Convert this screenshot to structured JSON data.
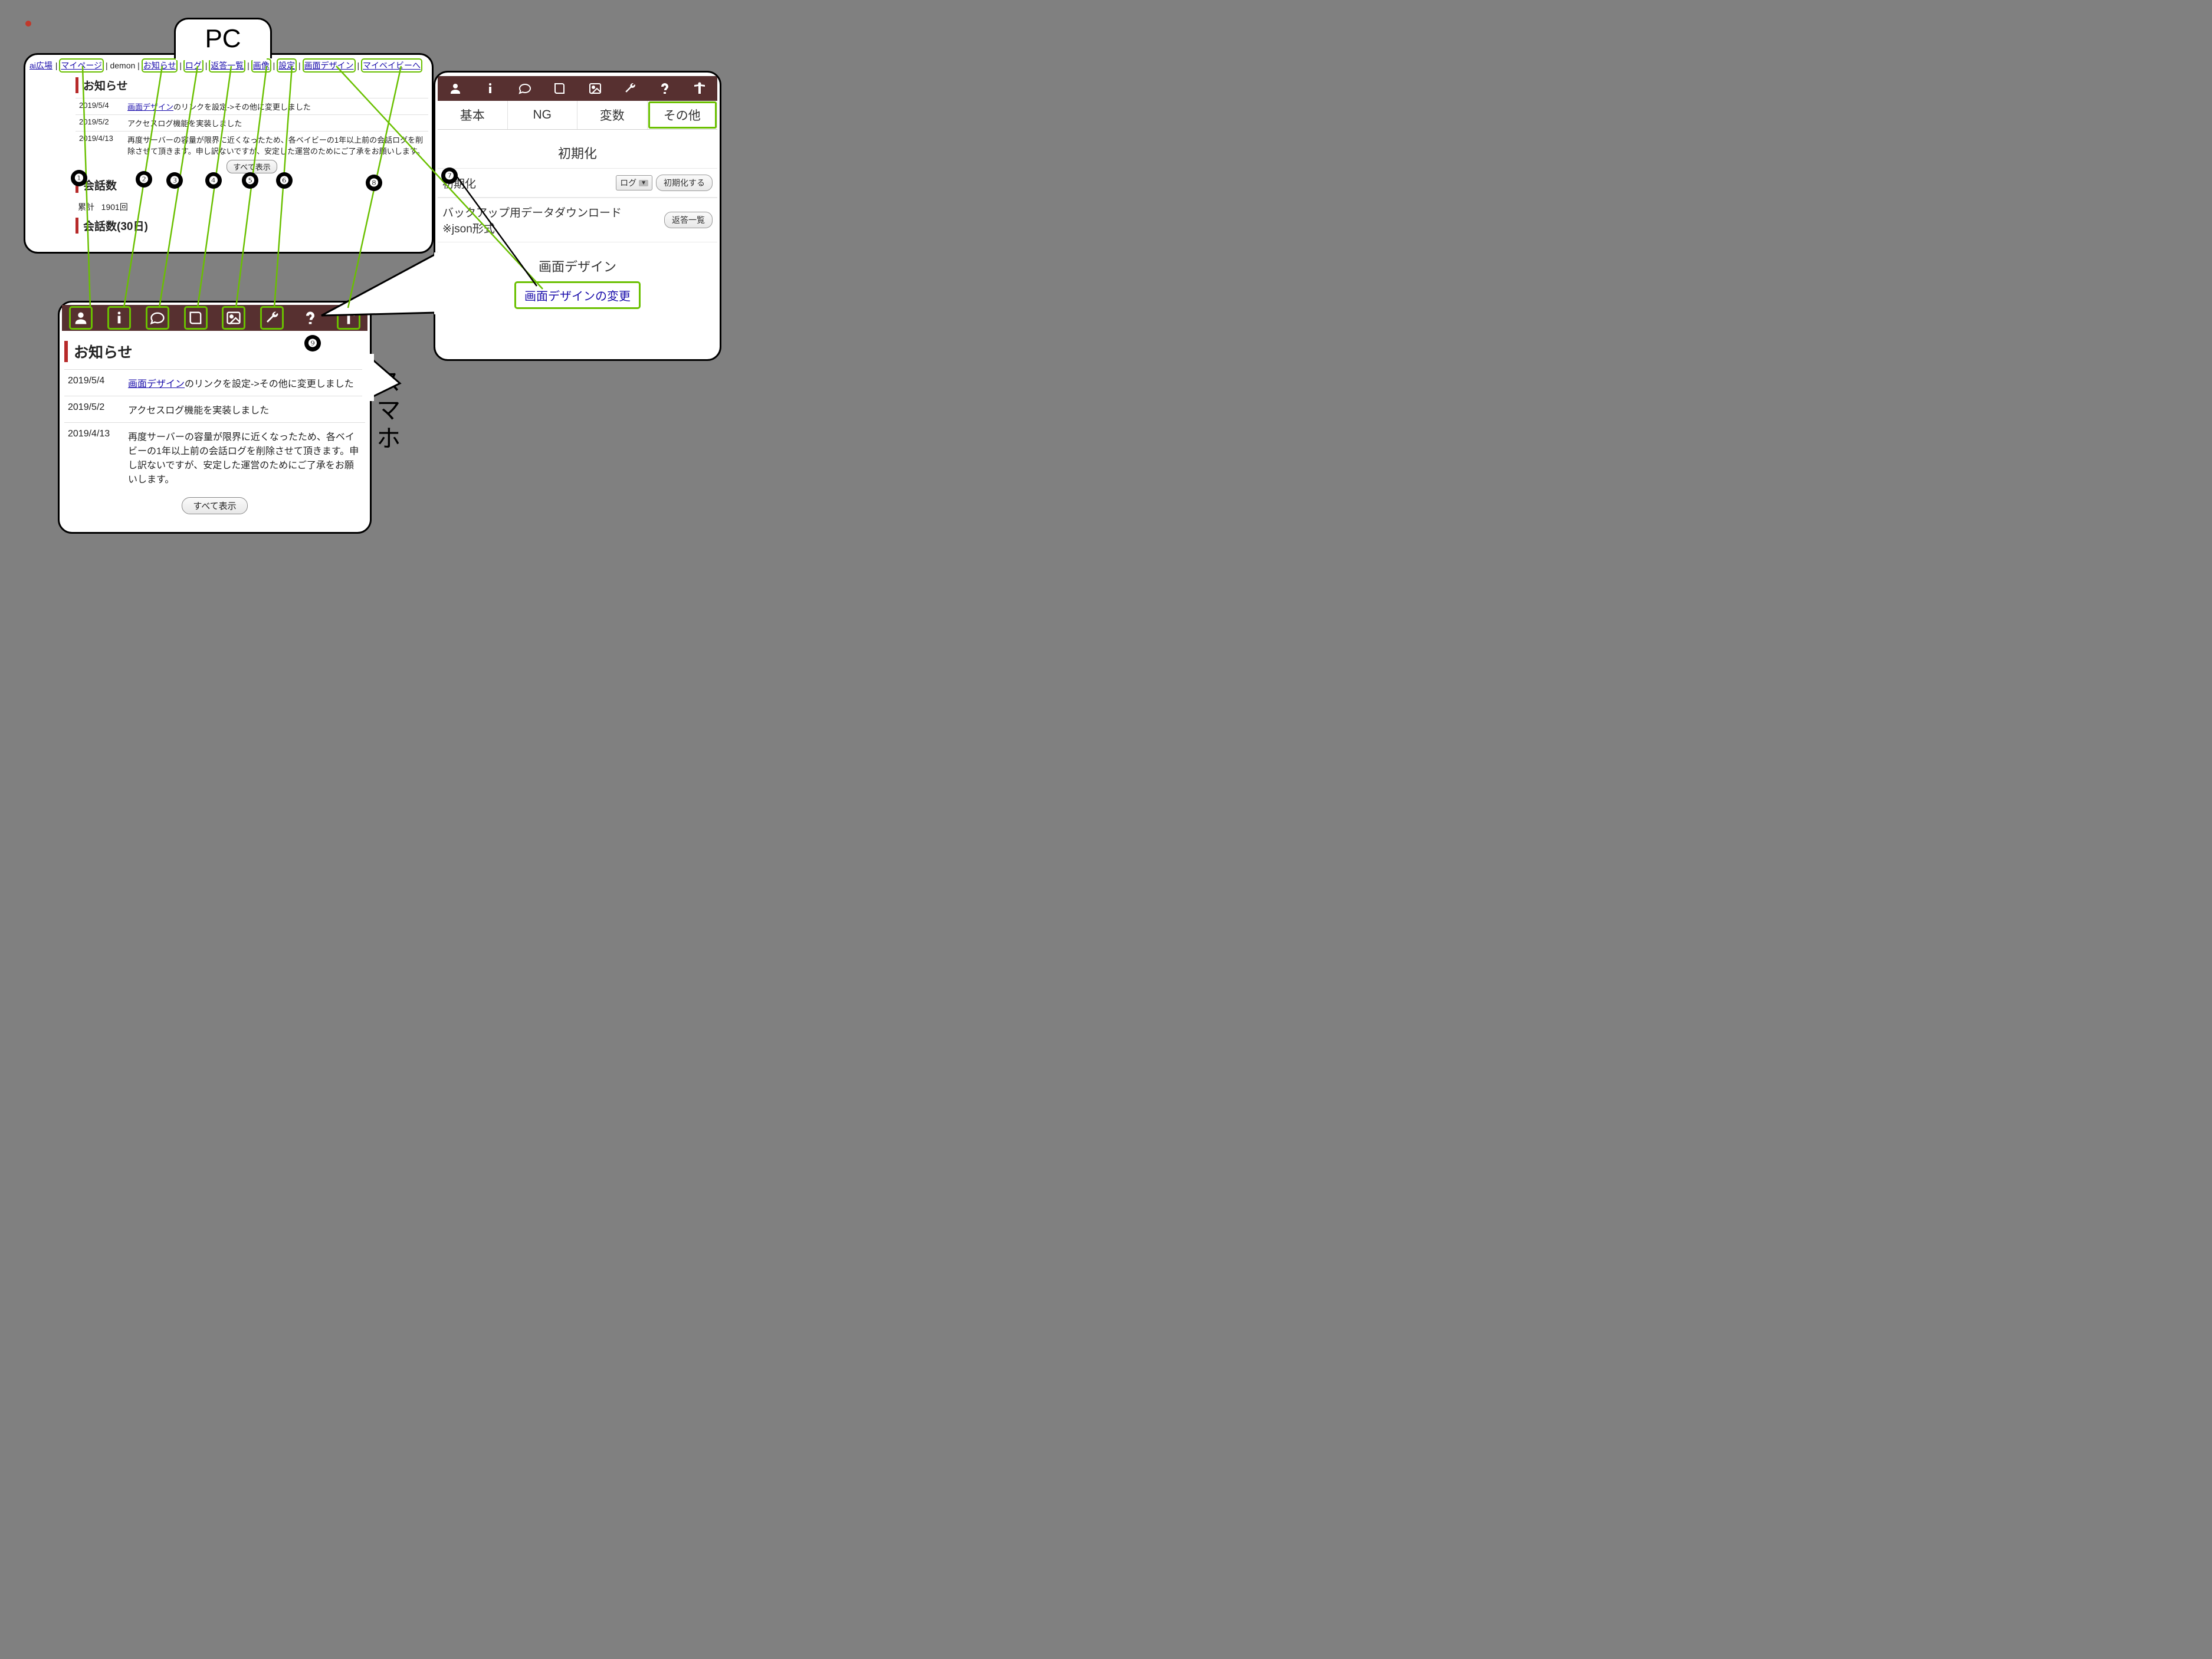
{
  "labels": {
    "pc": "PC",
    "sp": "スマホ"
  },
  "pc_nav": {
    "home": "ai広場",
    "mypage": "マイページ",
    "user": "demon",
    "news": "お知らせ",
    "log": "ログ",
    "replies": "返答一覧",
    "images": "画像",
    "settings": "設定",
    "design": "画面デザイン",
    "mybaby": "マイベイビーへ"
  },
  "news": {
    "heading": "お知らせ",
    "rows": [
      {
        "date": "2019/5/4",
        "link": "画面デザイン",
        "text_after": "のリンクを設定->その他に変更しました"
      },
      {
        "date": "2019/5/2",
        "text": "アクセスログ機能を実装しました"
      },
      {
        "date": "2019/4/13",
        "text": "再度サーバーの容量が限界に近くなったため、各ベイビーの1年以上前の会話ログを削除させて頂きます。申し訳ないですが、安定した運営のためにご了承をお願いします。"
      }
    ],
    "show_all": "すべて表示"
  },
  "stats": {
    "heading": "会話数",
    "total_label": "累計",
    "total_value": "1901回",
    "heading30": "会話数(30日)"
  },
  "settings_panel": {
    "tabs": {
      "basic": "基本",
      "ng": "NG",
      "vars": "変数",
      "other": "その他"
    },
    "init_heading": "初期化",
    "init_label": "初期化",
    "select_value": "ログ",
    "init_button": "初期化する",
    "backup_label_1": "バックアップ用データダウンロード",
    "backup_label_2": "※json形式",
    "backup_button": "返答一覧",
    "design_heading": "画面デザイン",
    "design_link": "画面デザインの変更"
  },
  "badges": [
    "❶",
    "❷",
    "❸",
    "❹",
    "❺",
    "❻",
    "❼",
    "❽",
    "❾"
  ]
}
